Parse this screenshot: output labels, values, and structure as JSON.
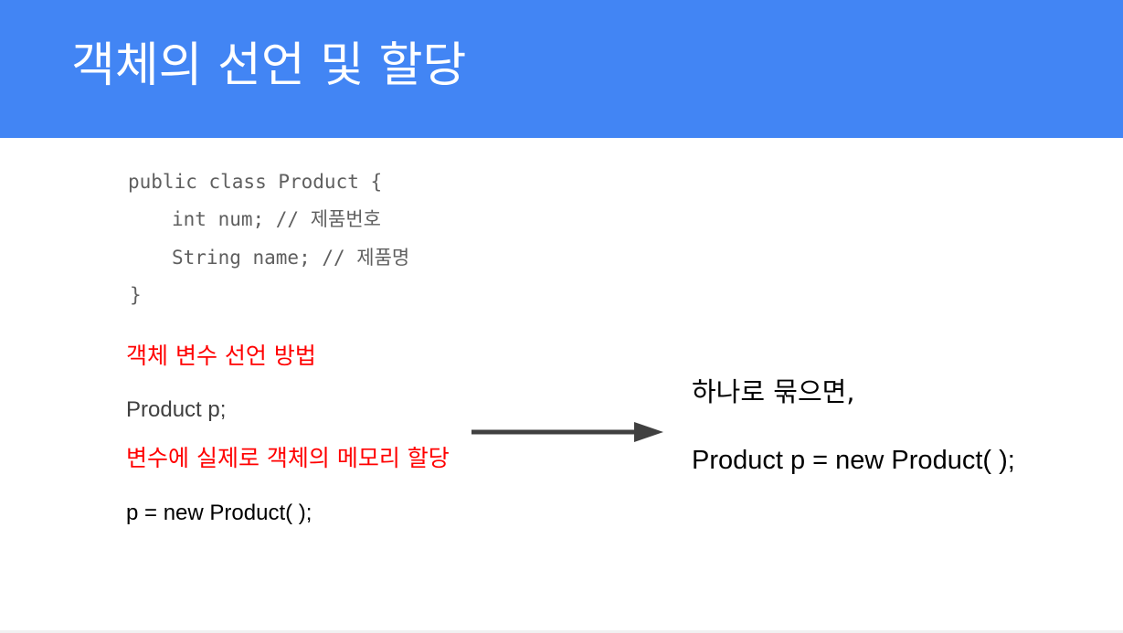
{
  "slide": {
    "title": "객체의 선언 및 할당"
  },
  "code_block": {
    "lines": [
      "public class Product {",
      "int num; // 제품번호",
      "String name; // 제품명",
      "}"
    ]
  },
  "left": {
    "declare_label": "객체 변수 선언 방법",
    "declare_code": "Product p;",
    "assign_label": "변수에 실제로 객체의 메모리 할당",
    "assign_code": "p = new Product( );"
  },
  "right": {
    "combined_label": "하나로 묶으면,",
    "combined_code": "Product p = new Product( );"
  },
  "colors": {
    "header": "#4285f4",
    "label_red": "#ff0000",
    "arrow": "#404040"
  },
  "icons": {
    "arrow": "right-arrow-icon"
  }
}
